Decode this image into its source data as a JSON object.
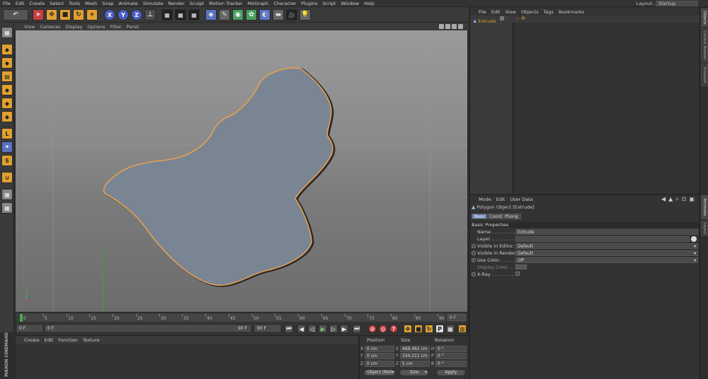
{
  "menubar": {
    "items": [
      "File",
      "Edit",
      "Create",
      "Select",
      "Tools",
      "Mesh",
      "Snap",
      "Animate",
      "Simulate",
      "Render",
      "Sculpt",
      "Motion Tracker",
      "MoGraph",
      "Character",
      "Plugins",
      "Script",
      "Window",
      "Help"
    ],
    "layout_label": "Layout:",
    "layout_value": "Startup"
  },
  "toolbar": {
    "axis_x": "X",
    "axis_y": "Y",
    "axis_z": "Z"
  },
  "viewport": {
    "menu": [
      "View",
      "Cameras",
      "Display",
      "Options",
      "Filter",
      "Panel"
    ]
  },
  "timeline": {
    "ticks": [
      "0",
      "5",
      "10",
      "15",
      "20",
      "25",
      "30",
      "35",
      "40",
      "45",
      "50",
      "55",
      "60",
      "65",
      "70",
      "75",
      "80",
      "85",
      "90"
    ],
    "end_field": "0 F"
  },
  "transport": {
    "current_frame": "0 F",
    "range_start": "0 F",
    "range_end": "90 F",
    "max_frame": "90 F"
  },
  "material_manager": {
    "menu": [
      "Create",
      "Edit",
      "Function",
      "Texture"
    ]
  },
  "coordinates": {
    "headers": [
      "Position",
      "Size",
      "Rotation"
    ],
    "rows": [
      {
        "axis": "X",
        "pos": "0 cm",
        "size_axis": "X",
        "size": "469.461 cm",
        "rot_axis": "H",
        "rot": "0 °"
      },
      {
        "axis": "Y",
        "pos": "0 cm",
        "size_axis": "Y",
        "size": "334.211 cm",
        "rot_axis": "P",
        "rot": "0 °"
      },
      {
        "axis": "Z",
        "pos": "0 cm",
        "size_axis": "Z",
        "size": "5 cm",
        "rot_axis": "B",
        "rot": "0 °"
      }
    ],
    "mode_select": "Object (Rel)",
    "size_select": "Size",
    "apply_label": "Apply"
  },
  "object_manager": {
    "menu": [
      "File",
      "Edit",
      "View",
      "Objects",
      "Tags",
      "Bookmarks"
    ],
    "object_name": "Extrude"
  },
  "attribute_manager": {
    "menu": [
      "Mode",
      "Edit",
      "User Data"
    ],
    "title": "Polygon Object [Extrude]",
    "tabs": [
      "Basic",
      "Coord.",
      "Phong"
    ],
    "section": "Basic Properties",
    "props": [
      {
        "label": "Name . . . . . . . . . . . .",
        "value": "Extrude"
      },
      {
        "label": "Layer. . . . . . . . . . . .",
        "value": ""
      },
      {
        "label": "Visible in Editor. . .",
        "value": "Default"
      },
      {
        "label": "Visible in Renderer",
        "value": "Default"
      },
      {
        "label": "Use Color. . . . . . . .",
        "value": "Off"
      },
      {
        "label": "Display Color. . . . .",
        "value": ""
      },
      {
        "label": "X-Ray . . . . . . . . . .",
        "value": ""
      }
    ]
  },
  "right_tabs": [
    "Objects",
    "Content Browser",
    "Structure",
    "Attributes",
    "Layers"
  ],
  "colors": {
    "shape_fill": "#7a8594",
    "shape_outline": "#e8a050",
    "accent": "#e0a030"
  }
}
